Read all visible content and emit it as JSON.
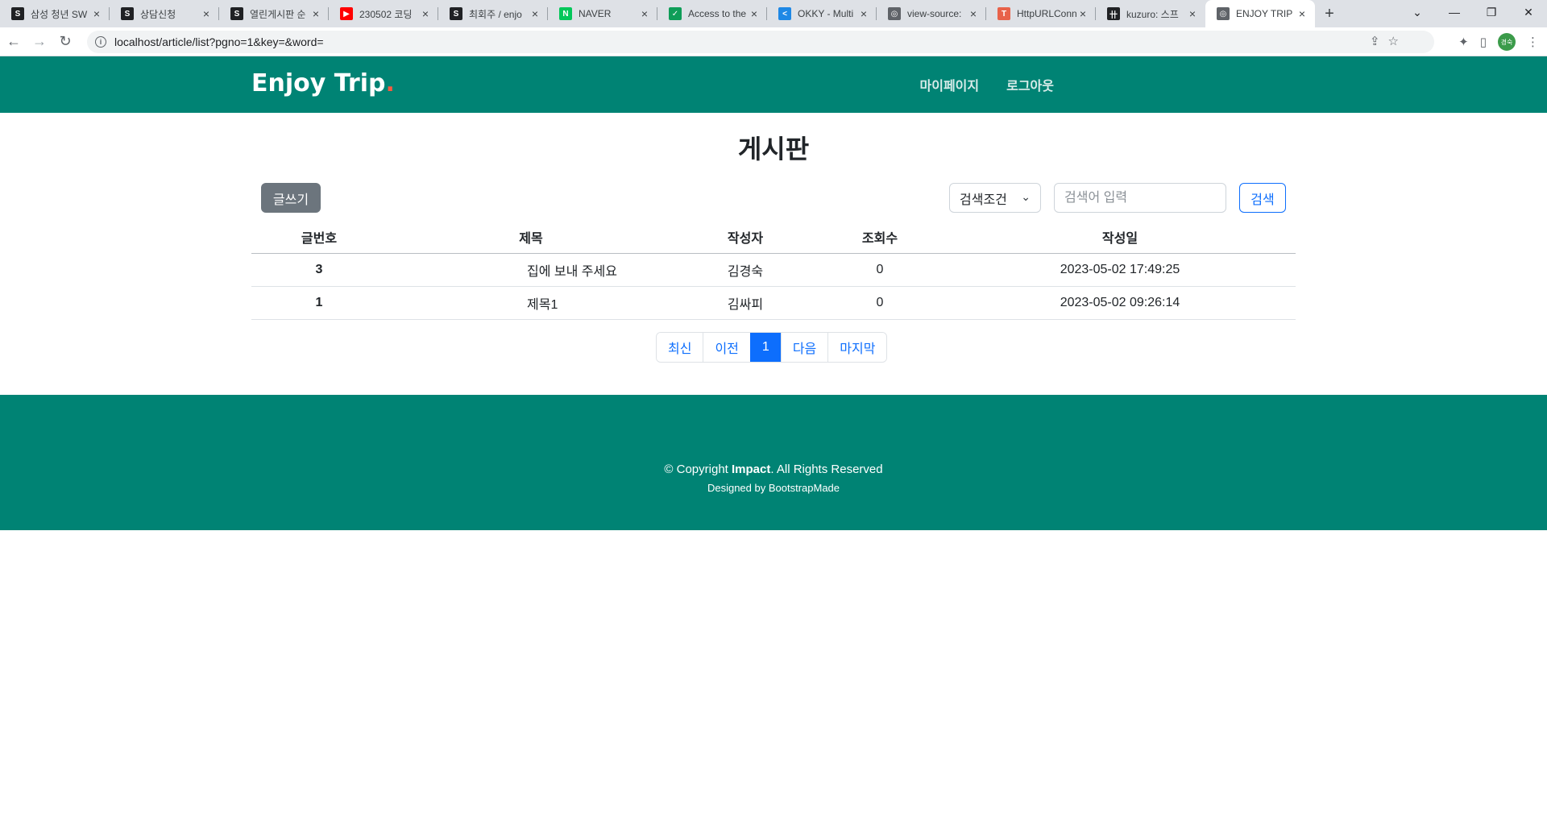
{
  "browser": {
    "tabs": [
      {
        "title": "삼성 청년 SW",
        "fav_color": "#202124",
        "fav_glyph": "S"
      },
      {
        "title": "상담신청",
        "fav_color": "#202124",
        "fav_glyph": "S"
      },
      {
        "title": "열린게시판 순",
        "fav_color": "#202124",
        "fav_glyph": "S"
      },
      {
        "title": "230502 코딩",
        "fav_color": "#ff0000",
        "fav_glyph": "▶"
      },
      {
        "title": "최회주 / enjo",
        "fav_color": "#202124",
        "fav_glyph": "S"
      },
      {
        "title": "NAVER",
        "fav_color": "#03c75a",
        "fav_glyph": "N"
      },
      {
        "title": "Access to the",
        "fav_color": "#0f9d58",
        "fav_glyph": "✓"
      },
      {
        "title": "OKKY - Multi",
        "fav_color": "#1e88e5",
        "fav_glyph": "<"
      },
      {
        "title": "view-source:",
        "fav_color": "#5f6368",
        "fav_glyph": "◎"
      },
      {
        "title": "HttpURLConn",
        "fav_color": "#e8624a",
        "fav_glyph": "T"
      },
      {
        "title": "kuzuro: 스프",
        "fav_color": "#202124",
        "fav_glyph": "卄"
      },
      {
        "title": "ENJOY TRIP",
        "fav_color": "#5f6368",
        "fav_glyph": "◎",
        "active": true
      }
    ],
    "close_glyph": "×",
    "new_tab_glyph": "+",
    "url": "localhost/article/list?pgno=1&key=&word=",
    "info_glyph": "i",
    "profile_label": "경숙"
  },
  "header": {
    "logo_text": "Enjoy Trip",
    "logo_dot": ".",
    "nav": {
      "mypage": "마이페이지",
      "logout": "로그아웃"
    }
  },
  "board": {
    "title": "게시판",
    "write_label": "글쓰기",
    "search_condition": "검색조건",
    "search_placeholder": "검색어 입력",
    "search_label": "검색",
    "columns": {
      "num": "글번호",
      "subject": "제목",
      "writer": "작성자",
      "hit": "조회수",
      "date": "작성일"
    },
    "rows": [
      {
        "num": "3",
        "subject": "집에 보내 주세요",
        "writer": "김경숙",
        "hit": "0",
        "date": "2023-05-02 17:49:25"
      },
      {
        "num": "1",
        "subject": "제목1",
        "writer": "김싸피",
        "hit": "0",
        "date": "2023-05-02 09:26:14"
      }
    ],
    "pagination": {
      "first": "최신",
      "prev": "이전",
      "current": "1",
      "next": "다음",
      "last": "마지막"
    }
  },
  "footer": {
    "copy_prefix": "© Copyright ",
    "copy_brand": "Impact",
    "copy_suffix": ". All Rights Reserved",
    "credit": "Designed by BootstrapMade"
  },
  "colors": {
    "brand": "#008374",
    "logo_dot": "#f85a40",
    "primary": "#0d6efd",
    "secondary": "#6c757d"
  }
}
